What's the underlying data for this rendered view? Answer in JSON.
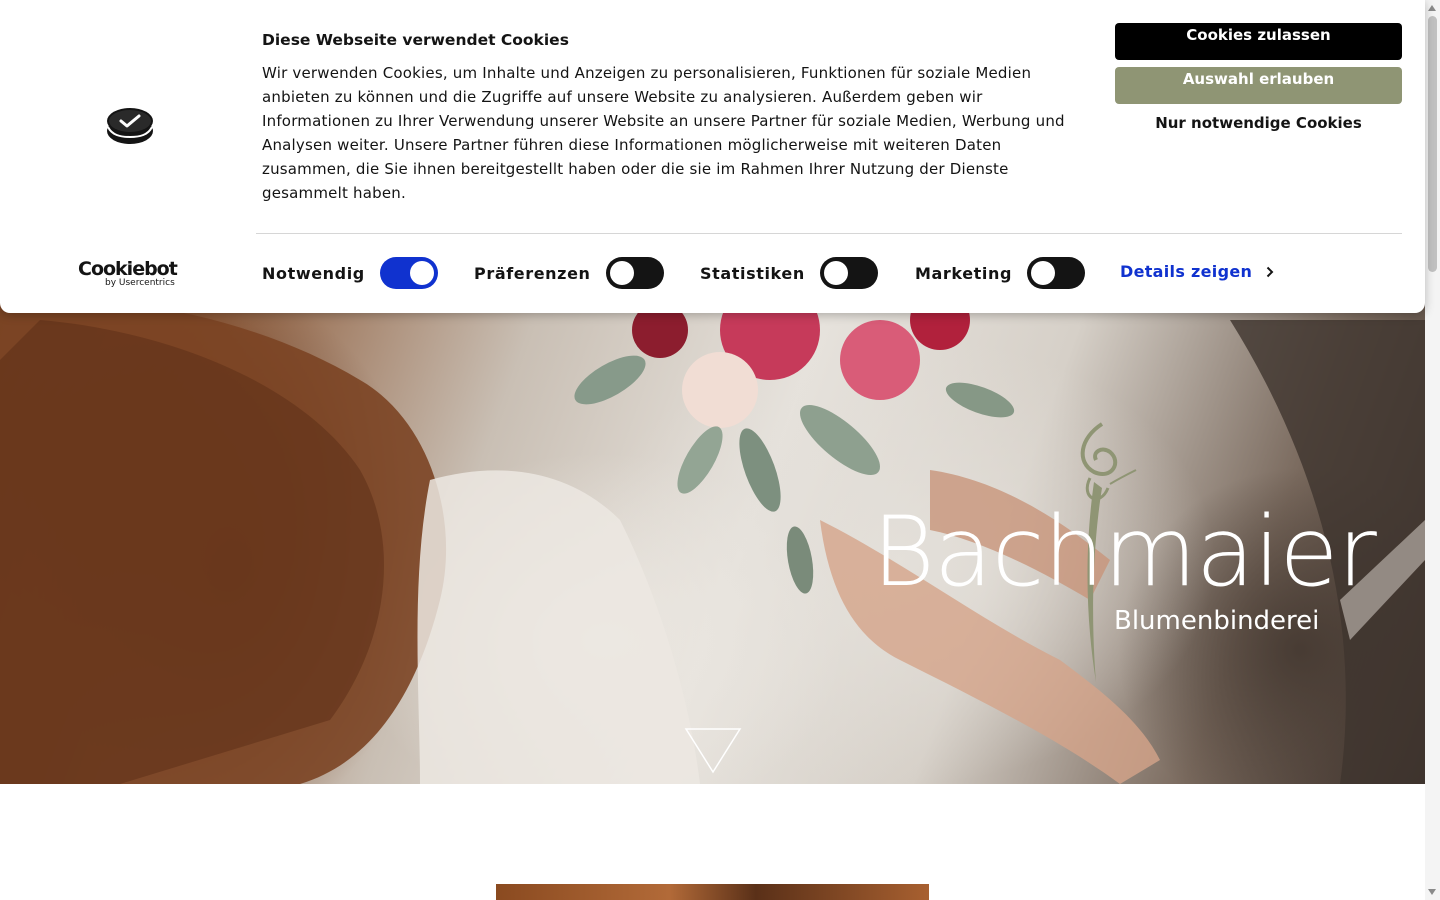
{
  "cookie_banner": {
    "title": "Diese Webseite verwendet Cookies",
    "text": "Wir verwenden Cookies, um Inhalte und Anzeigen zu personalisieren, Funktionen für soziale Medien anbieten zu können und die Zugriffe auf unsere Website zu analysieren. Außerdem geben wir Informationen zu Ihrer Verwendung unserer Website an unsere Partner für soziale Medien, Werbung und Analysen weiter. Unsere Partner führen diese Informationen möglicherweise mit weiteren Daten zusammen, die Sie ihnen bereitgestellt haben oder die sie im Rahmen Ihrer Nutzung der Dienste gesammelt haben.",
    "brand_main": "Cookiebot",
    "brand_sub": "by Usercentrics",
    "buttons": {
      "allow_all": "Cookies zulassen",
      "allow_selection": "Auswahl erlauben",
      "necessary_only": "Nur notwendige Cookies"
    },
    "consents": [
      {
        "label": "Notwendig",
        "checked": true
      },
      {
        "label": "Präferenzen",
        "checked": false
      },
      {
        "label": "Statistiken",
        "checked": false
      },
      {
        "label": "Marketing",
        "checked": false
      }
    ],
    "details_link": "Details zeigen",
    "colors": {
      "allow_all_bg": "#000000",
      "allow_selection_bg": "#8f9574",
      "toggle_on": "#1032cf",
      "toggle_off": "#141414",
      "link": "#1032cf"
    }
  },
  "hero": {
    "logo_name": "Bachmaier",
    "logo_tagline": "Blumenbinderei",
    "logo_accent_color": "#8f9574",
    "scroll_icon": "triangle-down-icon"
  }
}
